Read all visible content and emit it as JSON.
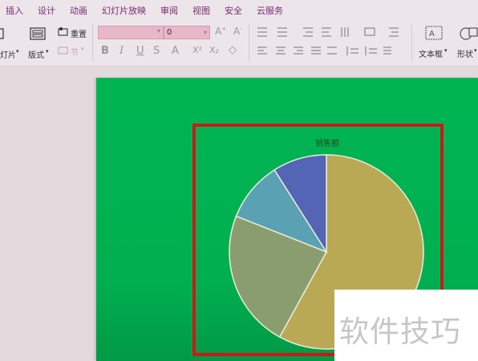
{
  "menu": [
    "插入",
    "设计",
    "动画",
    "幻灯片放映",
    "审阅",
    "视图",
    "安全",
    "云服务"
  ],
  "ribbon": {
    "new_slide_label": "灯片",
    "layout_label": "版式",
    "reset_label": "重置",
    "section_label": "节",
    "font_size_value": "0",
    "textbox_label": "文本框",
    "shape_label": "形状"
  },
  "colors": {
    "slide_bg": "#00b050",
    "frame": "#c91a1a"
  },
  "chart_data": {
    "type": "pie",
    "title": "销售额",
    "values": [
      58,
      23,
      10,
      9
    ],
    "colors": [
      "#b9a955",
      "#8a9d6e",
      "#5aa1b4",
      "#5465b5"
    ]
  },
  "watermark": "软件技巧"
}
